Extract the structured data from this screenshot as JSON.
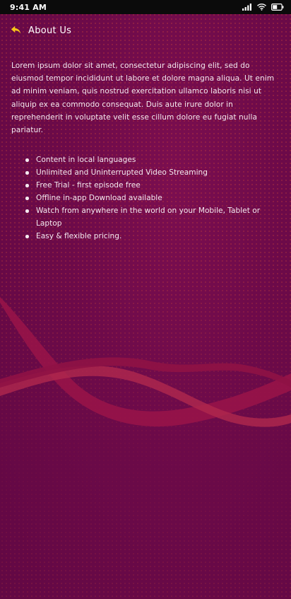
{
  "status_bar": {
    "time": "9:41 AM",
    "icons": [
      "signal-icon",
      "wifi-icon",
      "battery-icon"
    ]
  },
  "header": {
    "back_icon": "back-arrow-icon",
    "title": "About Us"
  },
  "content": {
    "intro": "Lorem ipsum dolor sit amet, consectetur adipiscing elit, sed do eiusmod tempor incididunt ut labore et dolore magna aliqua. Ut enim ad minim veniam, quis nostrud exercitation ullamco laboris nisi ut aliquip ex ea commodo consequat. Duis aute irure dolor in reprehenderit in voluptate velit esse cillum dolore eu fugiat nulla pariatur.",
    "features": [
      "Content in local languages",
      "Unlimited and Uninterrupted Video Streaming",
      "Free Trial - first episode free",
      "Offline in-app Download available",
      "Watch from anywhere in the world on your Mobile, Tablet or Laptop",
      "Easy & flexible pricing."
    ]
  },
  "colors": {
    "background": "#6a0b48",
    "accent_arrow": "#f5c518",
    "text": "#f4e9ef",
    "wave": "#a3164a"
  }
}
